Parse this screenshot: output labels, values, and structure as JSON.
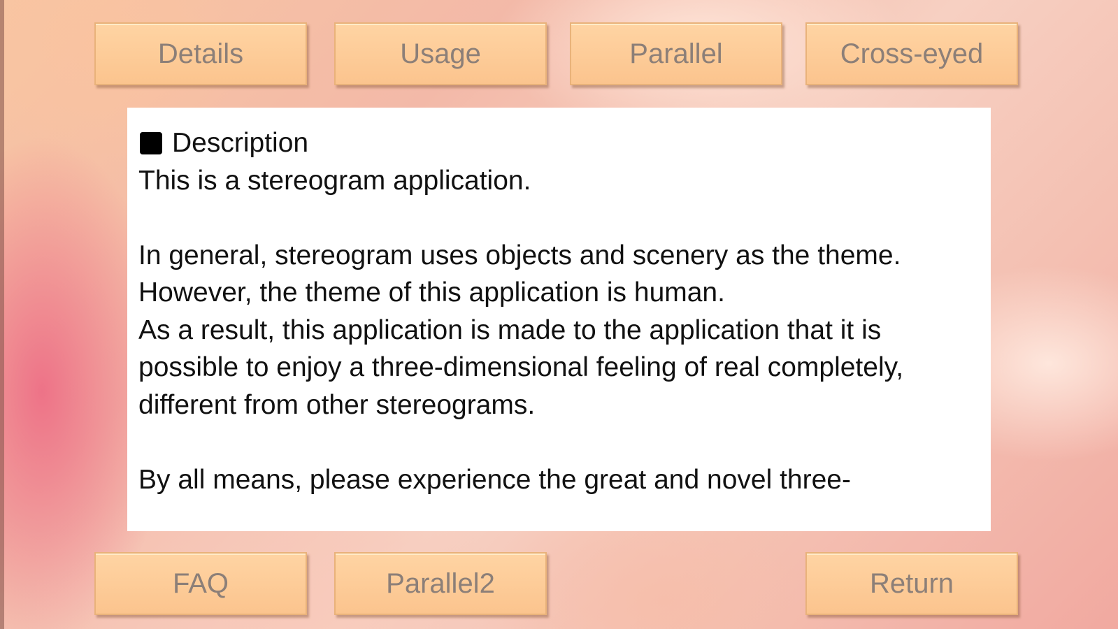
{
  "nav": {
    "details_label": "Details",
    "usage_label": "Usage",
    "parallel_label": "Parallel",
    "crosseyed_label": "Cross-eyed"
  },
  "content": {
    "heading": "Description",
    "line1": "This is a stereogram application.",
    "para2": "In general, stereogram uses objects and scenery as the theme.",
    "para3": "However, the theme of this application is human.",
    "para4": "As a result, this application is made to the application that it is possible to enjoy a three-dimensional feeling of real completely, different from other stereograms.",
    "para5": "By all means, please experience the great and novel three-"
  },
  "footer": {
    "faq_label": "FAQ",
    "parallel2_label": "Parallel2",
    "return_label": "Return"
  },
  "colors": {
    "button_fill": "#fbc48e",
    "button_text": "#8c7f78",
    "panel_bg": "#ffffff"
  }
}
